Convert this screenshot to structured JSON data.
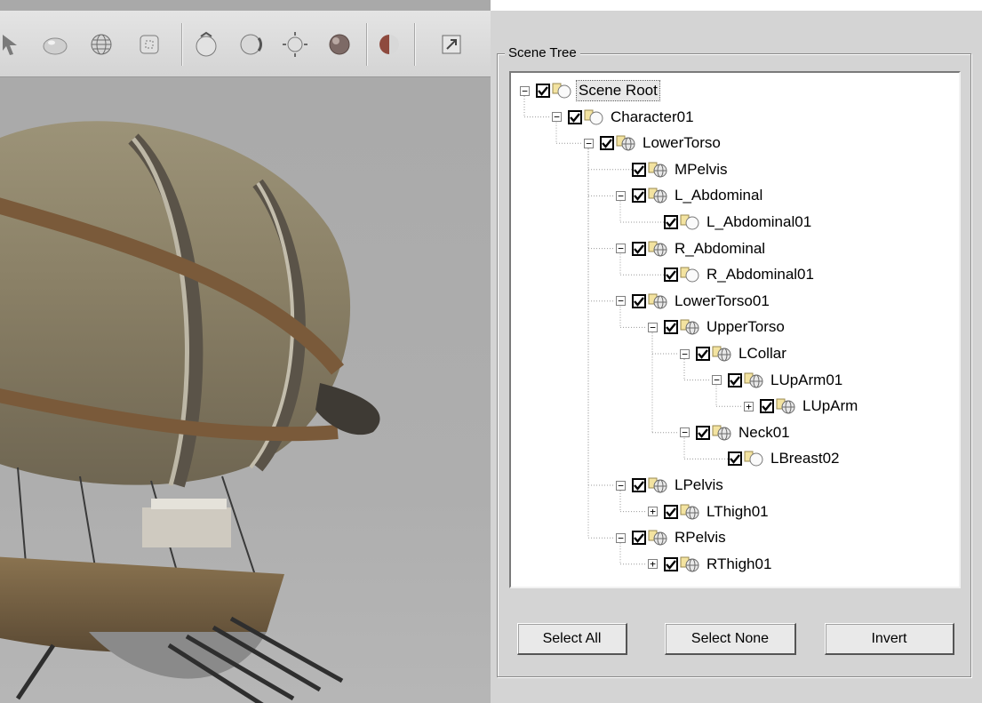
{
  "panel": {
    "title": "Scene Tree",
    "buttons": {
      "select_all": "Select All",
      "select_none": "Select None",
      "invert": "Invert"
    }
  },
  "toolbar": {
    "icons": [
      "cursor-icon",
      "sphere-icon",
      "globe-icon",
      "frame-icon",
      "rotate-icon",
      "orbit-icon",
      "zoom-extents-icon",
      "shaded-sphere-icon",
      "light-icon",
      "export-icon"
    ]
  },
  "tree": {
    "nodes": [
      {
        "label": "Scene Root",
        "depth": 0,
        "expander": "minus",
        "icon": "object-icon",
        "checked": true,
        "selected": true
      },
      {
        "label": "Character01",
        "depth": 1,
        "expander": "minus",
        "icon": "object-icon",
        "checked": true
      },
      {
        "label": "LowerTorso",
        "depth": 2,
        "expander": "minus",
        "icon": "mesh-icon",
        "checked": true
      },
      {
        "label": "MPelvis",
        "depth": 3,
        "expander": "none",
        "icon": "mesh-icon",
        "checked": true
      },
      {
        "label": "L_Abdominal",
        "depth": 3,
        "expander": "minus",
        "icon": "mesh-icon",
        "checked": true
      },
      {
        "label": "L_Abdominal01",
        "depth": 4,
        "expander": "none",
        "icon": "object-icon",
        "checked": true
      },
      {
        "label": "R_Abdominal",
        "depth": 3,
        "expander": "minus",
        "icon": "mesh-icon",
        "checked": true
      },
      {
        "label": "R_Abdominal01",
        "depth": 4,
        "expander": "none",
        "icon": "object-icon",
        "checked": true
      },
      {
        "label": "LowerTorso01",
        "depth": 3,
        "expander": "minus",
        "icon": "mesh-icon",
        "checked": true
      },
      {
        "label": "UpperTorso",
        "depth": 4,
        "expander": "minus",
        "icon": "mesh-icon",
        "checked": true
      },
      {
        "label": "LCollar",
        "depth": 5,
        "expander": "minus",
        "icon": "mesh-icon",
        "checked": true
      },
      {
        "label": "LUpArm01",
        "depth": 6,
        "expander": "minus",
        "icon": "mesh-icon",
        "checked": true
      },
      {
        "label": "LUpArm",
        "depth": 7,
        "expander": "plus",
        "icon": "mesh-icon",
        "checked": true
      },
      {
        "label": "Neck01",
        "depth": 5,
        "expander": "minus",
        "icon": "mesh-icon",
        "checked": true
      },
      {
        "label": "LBreast02",
        "depth": 6,
        "expander": "none",
        "icon": "object-icon",
        "checked": true
      },
      {
        "label": "LPelvis",
        "depth": 3,
        "expander": "minus",
        "icon": "mesh-icon",
        "checked": true
      },
      {
        "label": "LThigh01",
        "depth": 4,
        "expander": "plus",
        "icon": "mesh-icon",
        "checked": true
      },
      {
        "label": "RPelvis",
        "depth": 3,
        "expander": "minus",
        "icon": "mesh-icon",
        "checked": true
      },
      {
        "label": "RThigh01",
        "depth": 4,
        "expander": "plus",
        "icon": "mesh-icon",
        "checked": true
      }
    ]
  }
}
